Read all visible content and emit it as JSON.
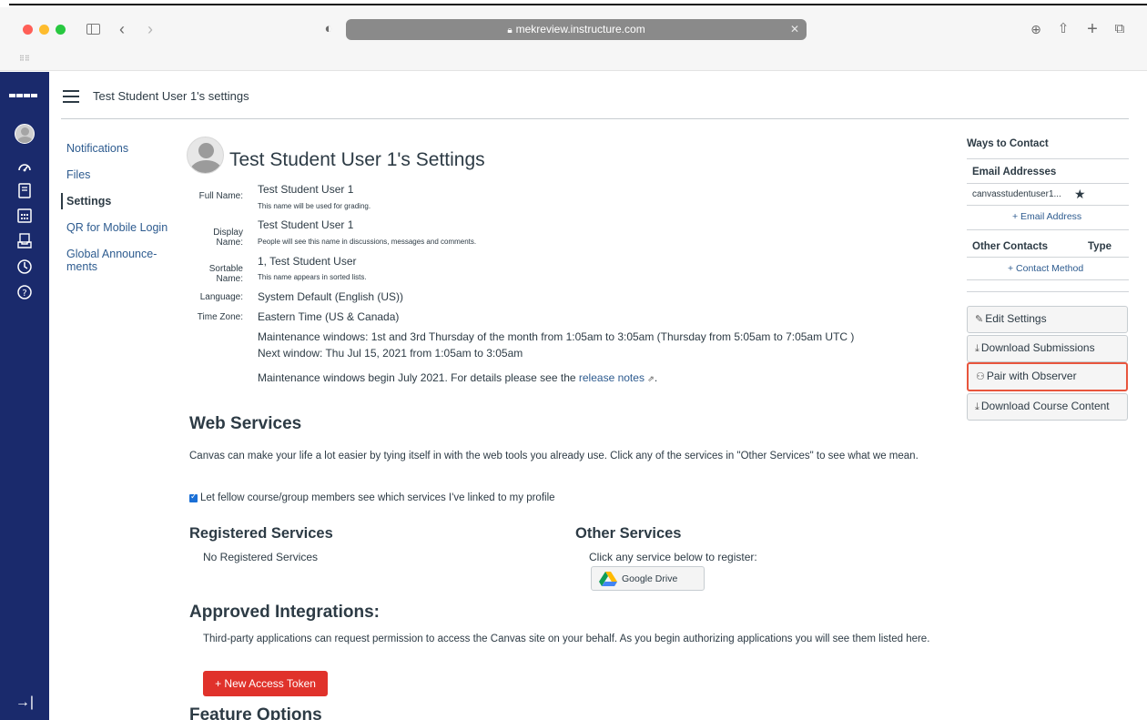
{
  "browser": {
    "url": "mekreview.instructure.com"
  },
  "page": {
    "breadcrumb": "Test Student User 1's settings",
    "title": "Test Student User 1's Settings"
  },
  "section_nav": [
    {
      "label": "Notifications",
      "active": false
    },
    {
      "label": "Files",
      "active": false
    },
    {
      "label": "Settings",
      "active": true
    },
    {
      "label": "QR for Mobile Login",
      "active": false
    },
    {
      "label": "Global Announce-\nments",
      "active": false
    }
  ],
  "profile": {
    "full_name_label": "Full Name:",
    "full_name": "Test Student User 1",
    "full_name_hint": "This name will be used for grading.",
    "display_name_label": "Display Name:",
    "display_name": "Test Student User 1",
    "display_name_hint": "People will see this name in discussions, messages and comments.",
    "sortable_name_label": "Sortable Name:",
    "sortable_name": "1, Test Student User",
    "sortable_name_hint": "This name appears in sorted lists.",
    "language_label": "Language:",
    "language": "System Default (English (US))",
    "time_zone_label": "Time Zone:",
    "time_zone": "Eastern Time (US & Canada)",
    "maintenance_line1": "Maintenance windows: 1st and 3rd Thursday of the month from 1:05am to 3:05am (Thursday from 5:05am to 7:05am UTC )",
    "maintenance_line2": "Next window: Thu Jul 15, 2021 from 1:05am to 3:05am",
    "maintenance_notice": "Maintenance windows begin July 2021. For details please see the ",
    "release_notes_link": "release notes",
    "period": "."
  },
  "web_services": {
    "heading": "Web Services",
    "description": "Canvas can make your life a lot easier by tying itself in with the web tools you already use. Click any of the services in \"Other Services\" to see what we mean.",
    "checkbox_label": "Let fellow course/group members see which services I've linked to my profile",
    "checkbox_checked": true,
    "registered_heading": "Registered Services",
    "registered_empty": "No Registered Services",
    "other_heading": "Other Services",
    "other_prompt": "Click any service below to register:",
    "google_drive_label": "Google Drive"
  },
  "approved_integrations": {
    "heading": "Approved Integrations:",
    "description": "Third-party applications can request permission to access the Canvas site on your behalf. As you begin authorizing applications you will see them listed here.",
    "new_token_label": "+ New Access Token"
  },
  "feature_options": {
    "heading": "Feature Options"
  },
  "right_sidebar": {
    "ways_to_contact": "Ways to Contact",
    "email_addresses": "Email Addresses",
    "email": "canvasstudentuser1...",
    "add_email": "+ Email Address",
    "other_contacts": "Other Contacts",
    "type": "Type",
    "add_contact": "+ Contact Method",
    "buttons": {
      "edit_settings": "Edit Settings",
      "download_submissions": "Download Submissions",
      "pair_with_observer": "Pair with Observer",
      "download_course_content": "Download Course Content"
    }
  },
  "colors": {
    "nav_bg": "#1a2a6c",
    "link": "#2d5b8f",
    "danger": "#e0322b",
    "highlight_border": "#e8553d"
  }
}
